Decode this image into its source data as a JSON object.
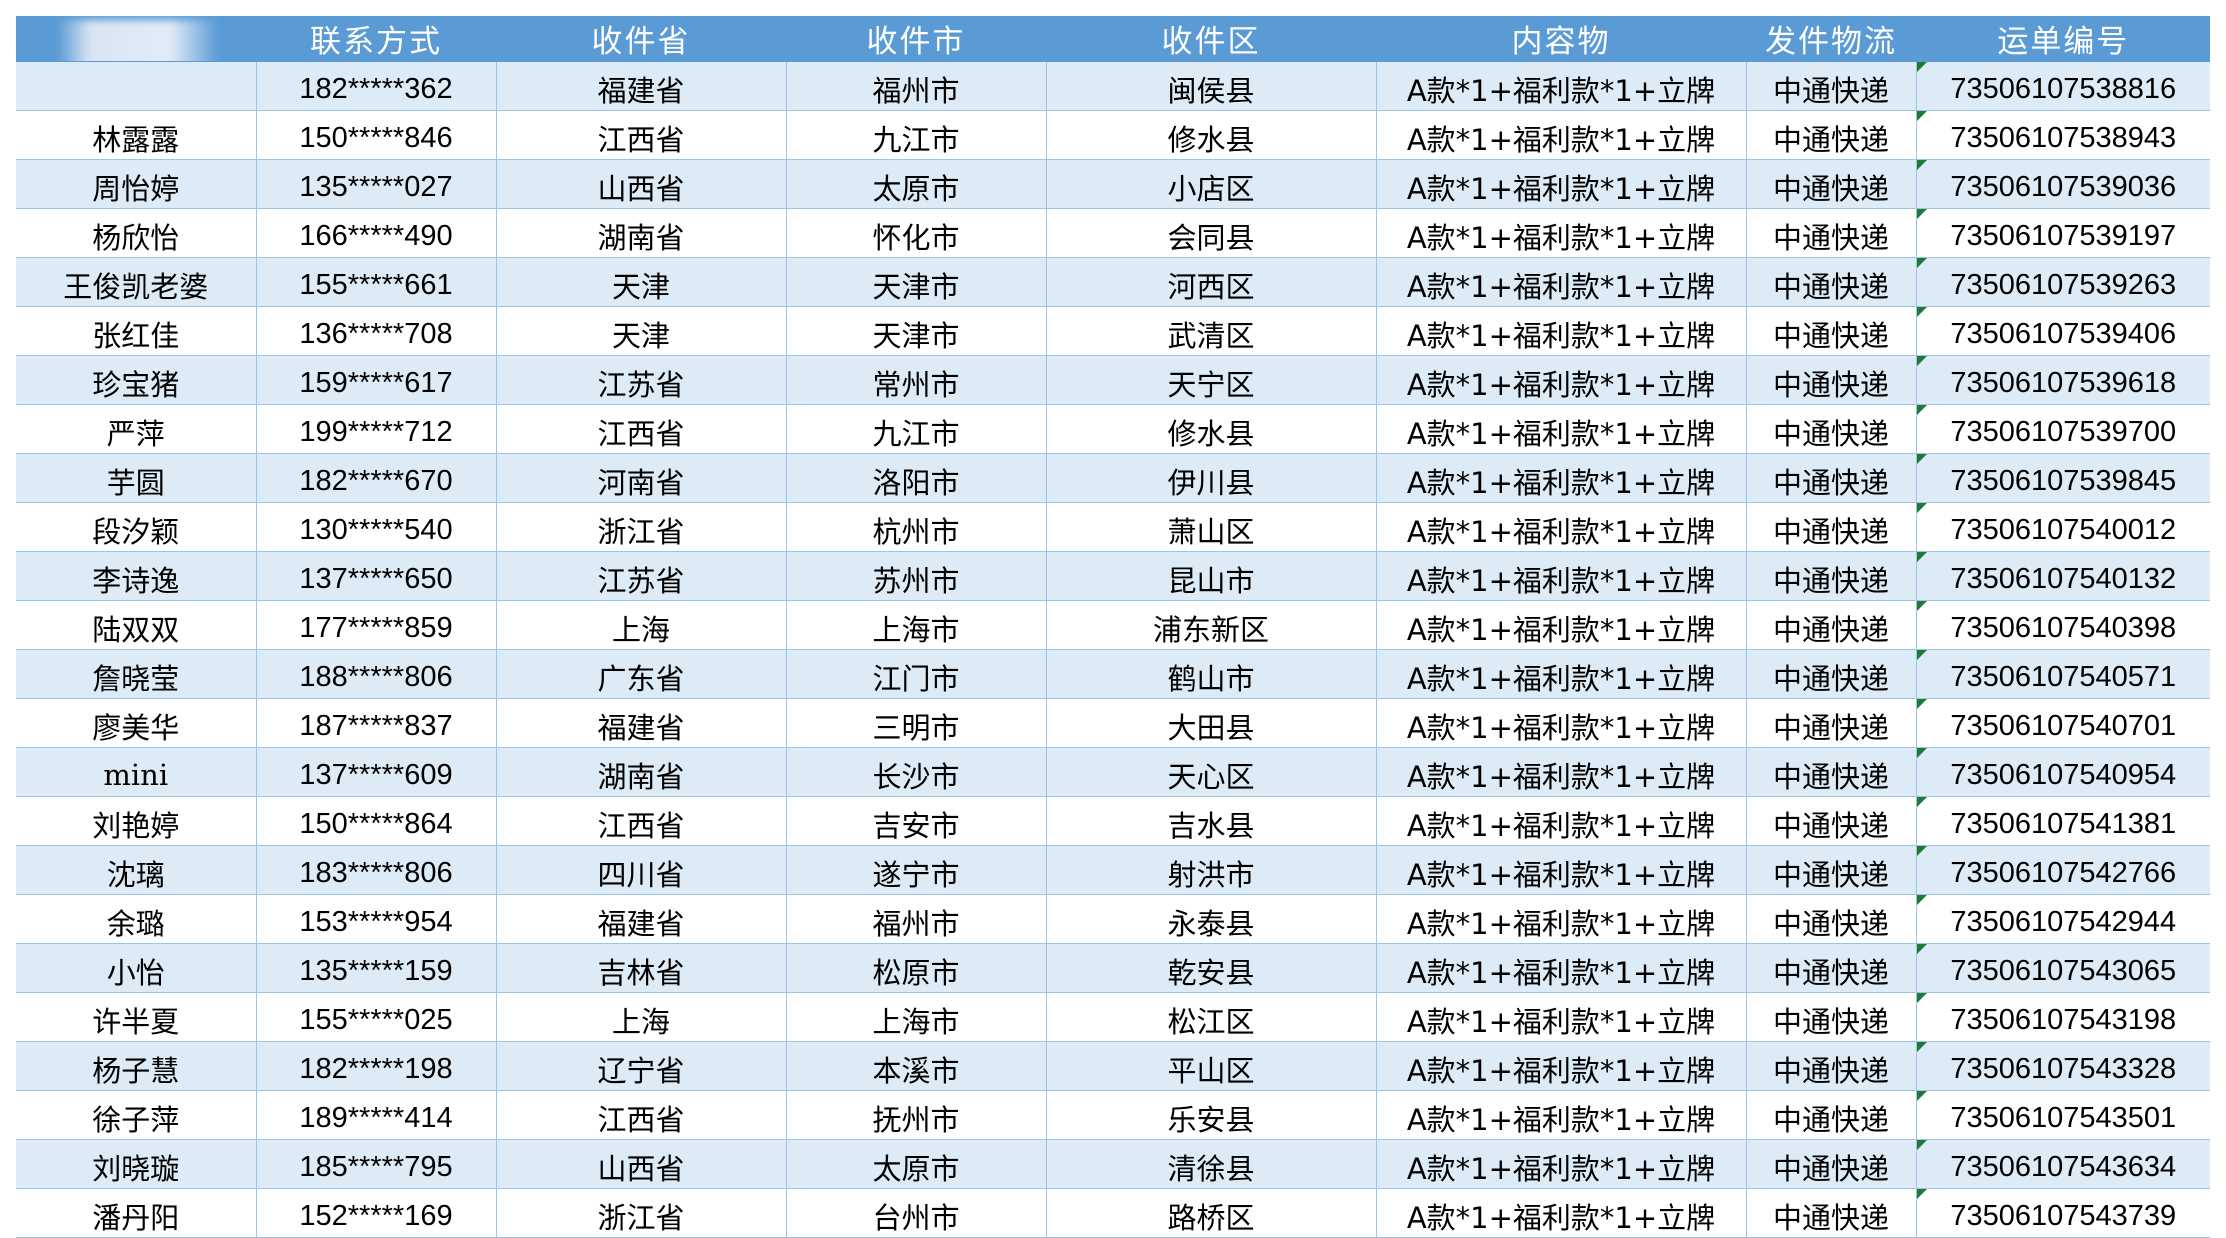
{
  "table": {
    "headers": [
      "",
      "联系方式",
      "收件省",
      "收件市",
      "收件区",
      "内容物",
      "发件物流",
      "运单编号"
    ],
    "rows": [
      [
        "",
        "182*****362",
        "福建省",
        "福州市",
        "闽侯县",
        "A款*1+福利款*1+立牌",
        "中通快递",
        "73506107538816"
      ],
      [
        "林露露",
        "150*****846",
        "江西省",
        "九江市",
        "修水县",
        "A款*1+福利款*1+立牌",
        "中通快递",
        "73506107538943"
      ],
      [
        "周怡婷",
        "135*****027",
        "山西省",
        "太原市",
        "小店区",
        "A款*1+福利款*1+立牌",
        "中通快递",
        "73506107539036"
      ],
      [
        "杨欣怡",
        "166*****490",
        "湖南省",
        "怀化市",
        "会同县",
        "A款*1+福利款*1+立牌",
        "中通快递",
        "73506107539197"
      ],
      [
        "王俊凯老婆",
        "155*****661",
        "天津",
        "天津市",
        "河西区",
        "A款*1+福利款*1+立牌",
        "中通快递",
        "73506107539263"
      ],
      [
        "张红佳",
        "136*****708",
        "天津",
        "天津市",
        "武清区",
        "A款*1+福利款*1+立牌",
        "中通快递",
        "73506107539406"
      ],
      [
        "珍宝猪",
        "159*****617",
        "江苏省",
        "常州市",
        "天宁区",
        "A款*1+福利款*1+立牌",
        "中通快递",
        "73506107539618"
      ],
      [
        "严萍",
        "199*****712",
        "江西省",
        "九江市",
        "修水县",
        "A款*1+福利款*1+立牌",
        "中通快递",
        "73506107539700"
      ],
      [
        "芋圆",
        "182*****670",
        "河南省",
        "洛阳市",
        "伊川县",
        "A款*1+福利款*1+立牌",
        "中通快递",
        "73506107539845"
      ],
      [
        "段汐颖",
        "130*****540",
        "浙江省",
        "杭州市",
        "萧山区",
        "A款*1+福利款*1+立牌",
        "中通快递",
        "73506107540012"
      ],
      [
        "李诗逸",
        "137*****650",
        "江苏省",
        "苏州市",
        "昆山市",
        "A款*1+福利款*1+立牌",
        "中通快递",
        "73506107540132"
      ],
      [
        "陆双双",
        "177*****859",
        "上海",
        "上海市",
        "浦东新区",
        "A款*1+福利款*1+立牌",
        "中通快递",
        "73506107540398"
      ],
      [
        "詹晓莹",
        "188*****806",
        "广东省",
        "江门市",
        "鹤山市",
        "A款*1+福利款*1+立牌",
        "中通快递",
        "73506107540571"
      ],
      [
        "廖美华",
        "187*****837",
        "福建省",
        "三明市",
        "大田县",
        "A款*1+福利款*1+立牌",
        "中通快递",
        "73506107540701"
      ],
      [
        "mini",
        "137*****609",
        "湖南省",
        "长沙市",
        "天心区",
        "A款*1+福利款*1+立牌",
        "中通快递",
        "73506107540954"
      ],
      [
        "刘艳婷",
        "150*****864",
        "江西省",
        "吉安市",
        "吉水县",
        "A款*1+福利款*1+立牌",
        "中通快递",
        "73506107541381"
      ],
      [
        "沈璃",
        "183*****806",
        "四川省",
        "遂宁市",
        "射洪市",
        "A款*1+福利款*1+立牌",
        "中通快递",
        "73506107542766"
      ],
      [
        "余璐",
        "153*****954",
        "福建省",
        "福州市",
        "永泰县",
        "A款*1+福利款*1+立牌",
        "中通快递",
        "73506107542944"
      ],
      [
        "小怡",
        "135*****159",
        "吉林省",
        "松原市",
        "乾安县",
        "A款*1+福利款*1+立牌",
        "中通快递",
        "73506107543065"
      ],
      [
        "许半夏",
        "155*****025",
        "上海",
        "上海市",
        "松江区",
        "A款*1+福利款*1+立牌",
        "中通快递",
        "73506107543198"
      ],
      [
        "杨子慧",
        "182*****198",
        "辽宁省",
        "本溪市",
        "平山区",
        "A款*1+福利款*1+立牌",
        "中通快递",
        "73506107543328"
      ],
      [
        "徐子萍",
        "189*****414",
        "江西省",
        "抚州市",
        "乐安县",
        "A款*1+福利款*1+立牌",
        "中通快递",
        "73506107543501"
      ],
      [
        "刘晓璇",
        "185*****795",
        "山西省",
        "太原市",
        "清徐县",
        "A款*1+福利款*1+立牌",
        "中通快递",
        "73506107543634"
      ],
      [
        "潘丹阳",
        "152*****169",
        "浙江省",
        "台州市",
        "路桥区",
        "A款*1+福利款*1+立牌",
        "中通快递",
        "73506107543739"
      ]
    ]
  },
  "colors": {
    "header_bg": "#5b9bd5",
    "header_text": "#ffffff",
    "band_row": "#ddebf7",
    "plain_row": "#ffffff",
    "grid_line": "#9fc3e6",
    "error_flag": "#1e7b34"
  }
}
